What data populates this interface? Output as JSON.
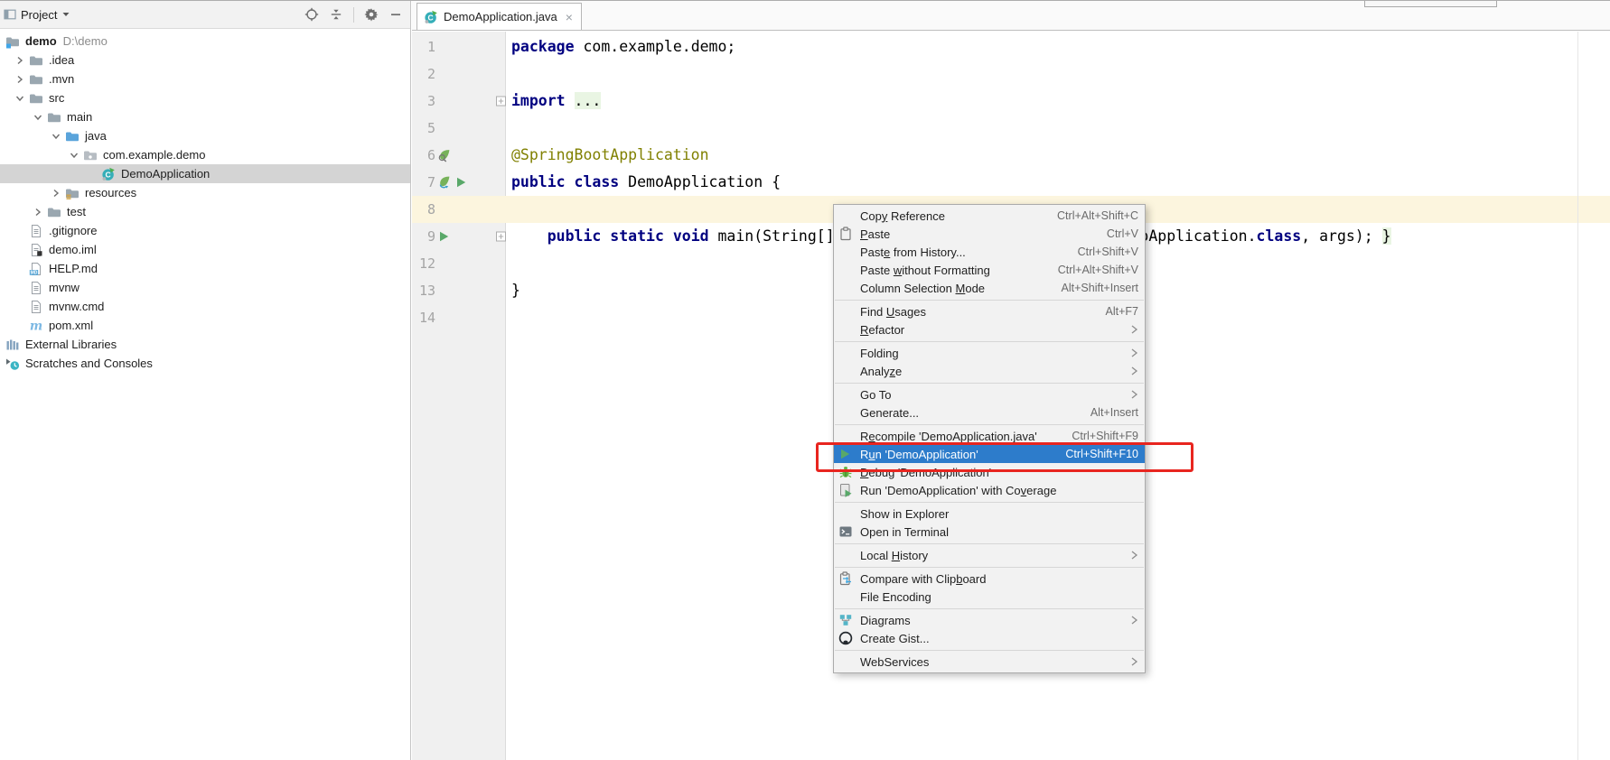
{
  "colors": {
    "menu_selection_blue": "#2D7CCB",
    "tree_selection_gray": "#D4D4D4",
    "caret_row_yellow": "#FCF5DE",
    "annotation_red": "#E8251F",
    "keyword_navy": "#000080",
    "java_annotation_olive": "#808000",
    "folded_region_green": "#E9F5E3",
    "run_green": "#59A869"
  },
  "project_panel": {
    "title": "Project",
    "dropdown_glyph": "▾",
    "actions": [
      {
        "name": "locate",
        "icon": "locate"
      },
      {
        "name": "collapse-all",
        "icon": "collapse-all"
      },
      {
        "name": "separator"
      },
      {
        "name": "settings",
        "icon": "gear"
      },
      {
        "name": "hide",
        "icon": "minus"
      }
    ],
    "tree": [
      {
        "label": "demo",
        "hint": "D:\\demo",
        "level": 0,
        "icon": "project-folder",
        "bold": true
      },
      {
        "label": ".idea",
        "level": 1,
        "chevron": "right",
        "icon": "folder"
      },
      {
        "label": ".mvn",
        "level": 1,
        "chevron": "right",
        "icon": "folder"
      },
      {
        "label": "src",
        "level": 1,
        "chevron": "down",
        "icon": "folder"
      },
      {
        "label": "main",
        "level": 2,
        "chevron": "down",
        "icon": "folder"
      },
      {
        "label": "java",
        "level": 3,
        "chevron": "down",
        "icon": "folder-source"
      },
      {
        "label": "com.example.demo",
        "level": 4,
        "chevron": "down",
        "icon": "package"
      },
      {
        "label": "DemoApplication",
        "level": 5,
        "icon": "class-run",
        "selected": true
      },
      {
        "label": "resources",
        "level": 3,
        "chevron": "right",
        "icon": "folder-resources"
      },
      {
        "label": "test",
        "level": 2,
        "chevron": "right",
        "icon": "folder"
      },
      {
        "label": ".gitignore",
        "level": 1,
        "icon": "file"
      },
      {
        "label": "demo.iml",
        "level": 1,
        "icon": "file-iml"
      },
      {
        "label": "HELP.md",
        "level": 1,
        "icon": "file-md"
      },
      {
        "label": "mvnw",
        "level": 1,
        "icon": "file"
      },
      {
        "label": "mvnw.cmd",
        "level": 1,
        "icon": "file"
      },
      {
        "label": "pom.xml",
        "level": 1,
        "icon": "maven"
      },
      {
        "label": "External Libraries",
        "level": 0,
        "icon": "libraries"
      },
      {
        "label": "Scratches and Consoles",
        "level": 0,
        "icon": "scratches"
      }
    ]
  },
  "editor": {
    "tab": {
      "label": "DemoApplication.java",
      "icon": "class-run",
      "close_glyph": "×"
    },
    "lines": [
      {
        "num": "1",
        "segments": [
          {
            "text": "package ",
            "type": "keyword"
          },
          {
            "text": "com.example.demo;",
            "type": "plain"
          }
        ]
      },
      {
        "num": "2",
        "segments": []
      },
      {
        "num": "3",
        "fold": true,
        "segments": [
          {
            "text": "import ",
            "type": "keyword"
          },
          {
            "text": "...",
            "type": "folded"
          }
        ]
      },
      {
        "num": "5",
        "segments": []
      },
      {
        "num": "6",
        "gutter_icons": [
          "spring-bean"
        ],
        "segments": [
          {
            "text": "@SpringBootApplication",
            "type": "annotation"
          }
        ]
      },
      {
        "num": "7",
        "gutter_icons": [
          "spring-run",
          "run"
        ],
        "segments": [
          {
            "text": "public class ",
            "type": "keyword"
          },
          {
            "text": "DemoApplication {",
            "type": "plain"
          }
        ]
      },
      {
        "num": "8",
        "highlight": true,
        "segments": []
      },
      {
        "num": "9",
        "gutter_icons": [
          "run"
        ],
        "fold": true,
        "segments": [
          {
            "text": "    ",
            "type": "plain"
          },
          {
            "text": "public static void ",
            "type": "keyword"
          },
          {
            "text": "main(String[] args) { SpringApplication.run(DemoApplication.",
            "type": "plain"
          },
          {
            "text": "class",
            "type": "keyword"
          },
          {
            "text": ", args); ",
            "type": "plain"
          },
          {
            "text": "}",
            "type": "folded"
          }
        ]
      },
      {
        "num": "12",
        "segments": []
      },
      {
        "num": "13",
        "segments": [
          {
            "text": "}",
            "type": "plain"
          }
        ]
      },
      {
        "num": "14",
        "segments": []
      }
    ]
  },
  "context_menu": {
    "items": [
      {
        "label": "Copy Reference",
        "shortcut": "Ctrl+Alt+Shift+C",
        "mnemonic": 3
      },
      {
        "label": "Paste",
        "icon": "paste",
        "shortcut": "Ctrl+V",
        "mnemonic": 0
      },
      {
        "label": "Paste from History...",
        "shortcut": "Ctrl+Shift+V",
        "mnemonic": 4
      },
      {
        "label": "Paste without Formatting",
        "shortcut": "Ctrl+Alt+Shift+V",
        "mnemonic": 6
      },
      {
        "label": "Column Selection Mode",
        "shortcut": "Alt+Shift+Insert",
        "mnemonic": 17
      },
      {
        "sep": true
      },
      {
        "label": "Find Usages",
        "shortcut": "Alt+F7",
        "mnemonic": 5
      },
      {
        "label": "Refactor",
        "submenu": true,
        "mnemonic": 0
      },
      {
        "sep": true
      },
      {
        "label": "Folding",
        "submenu": true
      },
      {
        "label": "Analyze",
        "submenu": true,
        "mnemonic": 5
      },
      {
        "sep": true
      },
      {
        "label": "Go To",
        "submenu": true
      },
      {
        "label": "Generate...",
        "shortcut": "Alt+Insert"
      },
      {
        "sep": true
      },
      {
        "label": "Recompile 'DemoApplication.java'",
        "shortcut": "Ctrl+Shift+F9",
        "mnemonic": 1
      },
      {
        "label": "Run 'DemoApplication'",
        "icon": "run",
        "shortcut": "Ctrl+Shift+F10",
        "mnemonic": 1,
        "selected": true
      },
      {
        "label": "Debug 'DemoApplication'",
        "icon": "debug",
        "mnemonic": 0
      },
      {
        "label": "Run 'DemoApplication' with Coverage",
        "icon": "coverage",
        "mnemonic": 29
      },
      {
        "sep": true
      },
      {
        "label": "Show in Explorer"
      },
      {
        "label": "Open in Terminal",
        "icon": "terminal"
      },
      {
        "sep": true
      },
      {
        "label": "Local History",
        "submenu": true,
        "mnemonic": 6
      },
      {
        "sep": true
      },
      {
        "label": "Compare with Clipboard",
        "icon": "compare-clipboard",
        "mnemonic": 17
      },
      {
        "label": "File Encoding"
      },
      {
        "sep": true
      },
      {
        "label": "Diagrams",
        "icon": "diagrams",
        "submenu": true
      },
      {
        "label": "Create Gist...",
        "icon": "github"
      },
      {
        "sep": true
      },
      {
        "label": "WebServices",
        "submenu": true
      }
    ]
  }
}
